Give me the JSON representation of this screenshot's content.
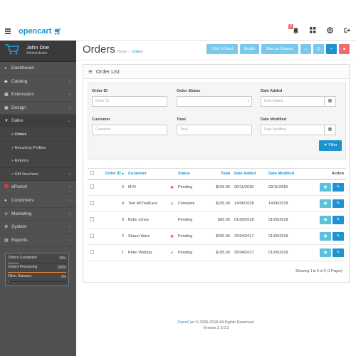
{
  "header": {
    "logo_text": "opencart",
    "alert_count": "5",
    "icons": [
      "hamburger-icon",
      "bell-icon",
      "grid-icon",
      "lifebuoy-icon",
      "sign-out-icon"
    ]
  },
  "profile": {
    "name": "John Doe",
    "role": "Administrator"
  },
  "sidebar": {
    "items": [
      {
        "label": "Dashboard",
        "icon": "dashboard-icon"
      },
      {
        "label": "Catalog",
        "icon": "tag-icon"
      },
      {
        "label": "Extensions",
        "icon": "puzzle-icon"
      },
      {
        "label": "Design",
        "icon": "television-icon"
      },
      {
        "label": "Sales",
        "icon": "shopping-cart-icon"
      }
    ],
    "sub_items": [
      {
        "label": "Orders"
      },
      {
        "label": "Recurring Profiles"
      },
      {
        "label": "Returns"
      },
      {
        "label": "Gift Vouchers"
      }
    ],
    "items2": [
      {
        "label": "eParcel",
        "icon": "eparcel-icon"
      },
      {
        "label": "Customers",
        "icon": "user-icon"
      },
      {
        "label": "Marketing",
        "icon": "share-icon"
      },
      {
        "label": "System",
        "icon": "cog-icon"
      },
      {
        "label": "Reports",
        "icon": "bar-chart-icon"
      }
    ],
    "stats": [
      {
        "label": "Orders Completed",
        "value": "20%",
        "fraction": 0.2,
        "color": "#8fbb6c"
      },
      {
        "label": "Orders Processing",
        "value": "100%",
        "fraction": 1.0,
        "color": "#f38733"
      },
      {
        "label": "Other Statuses",
        "value": "3%",
        "fraction": 0.03,
        "color": "#888888"
      }
    ]
  },
  "page": {
    "title": "Orders",
    "breadcrumb": [
      "Home",
      "Orders"
    ],
    "buttons": [
      "Click 'N Send",
      "Sendle",
      "Mark as Shipped"
    ]
  },
  "panel": {
    "title": "Order List"
  },
  "filter": {
    "order_id_label": "Order ID",
    "order_id_placeholder": "Order ID",
    "order_status_label": "Order Status",
    "date_added_label": "Date Added",
    "date_added_placeholder": "Date Added",
    "customer_label": "Customer",
    "customer_placeholder": "Customer",
    "total_label": "Total",
    "total_placeholder": "Total",
    "date_modified_label": "Date Modified",
    "date_modified_placeholder": "Date Modified",
    "button_label": "Filter"
  },
  "table": {
    "headers": {
      "order_id": "Order ID",
      "customer": "Customer",
      "status": "Status",
      "total": "Total",
      "date_added": "Date Added",
      "date_modified": "Date Modified",
      "action": "Action"
    },
    "rows": [
      {
        "id": "5",
        "customer": "M M",
        "mark": "x",
        "status": "Pending",
        "total": "$106.00",
        "date_added": "09/11/2018",
        "date_modified": "09/11/2018"
      },
      {
        "id": "4",
        "customer": "Test McTestFace",
        "mark": "ok",
        "status": "Complete",
        "total": "$105.00",
        "date_added": "14/06/2018",
        "date_modified": "14/06/2018"
      },
      {
        "id": "3",
        "customer": "Bobo Jones",
        "mark": "",
        "status": "Pending",
        "total": "$65.00",
        "date_added": "01/05/2018",
        "date_modified": "01/05/2018"
      },
      {
        "id": "2",
        "customer": "Shaun Ware",
        "mark": "x",
        "status": "Pending",
        "total": "$205.00",
        "date_added": "25/04/2017",
        "date_modified": "01/05/2018"
      },
      {
        "id": "1",
        "customer": "Peter Widdup",
        "mark": "ok",
        "status": "Pending",
        "total": "$185.00",
        "date_added": "25/04/2017",
        "date_modified": "01/05/2018"
      }
    ],
    "showing": "Showing 1 to 5 of 5 (1 Pages)"
  },
  "footer": {
    "link": "OpenCart",
    "copyright": "© 2009-2018 All Rights Reserved.",
    "version": "Version 2.3.0.2"
  },
  "colors": {
    "brand": "#1e91cf",
    "sidebar": "#515151",
    "danger": "#f56b6b",
    "info": "#7ac8ec"
  }
}
